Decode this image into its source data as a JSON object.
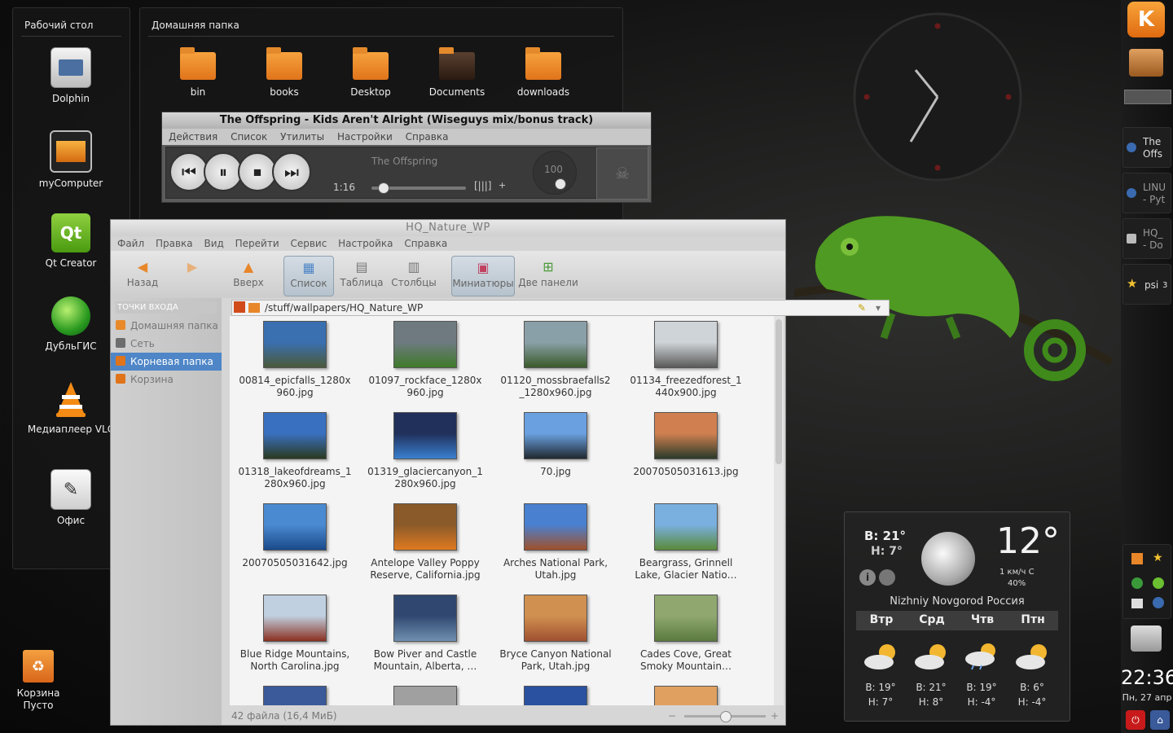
{
  "desktop_panel": {
    "title": "Рабочий стол",
    "icons": [
      {
        "label": "Dolphin",
        "icon": "dolphin-icon"
      },
      {
        "label": "myComputer",
        "icon": "computer-icon"
      },
      {
        "label": "Qt Creator",
        "icon": "qt-creator-icon"
      },
      {
        "label": "ДубльГИС",
        "icon": "dublgis-icon"
      },
      {
        "label": "Медиаплеер VLC",
        "icon": "vlc-icon"
      },
      {
        "label": "Офис",
        "icon": "office-icon"
      }
    ]
  },
  "home_panel": {
    "title": "Домашняя папка",
    "items": [
      {
        "label": "bin"
      },
      {
        "label": "books"
      },
      {
        "label": "Desktop"
      },
      {
        "label": "Documents"
      },
      {
        "label": "downloads"
      }
    ]
  },
  "trash_desktop": {
    "label": "Корзина",
    "sublabel": "Пусто"
  },
  "player": {
    "title": "The Offspring - Kids Aren't Alright (Wiseguys mix/bonus track)",
    "menu": [
      "Действия",
      "Список",
      "Утилиты",
      "Настройки",
      "Справка"
    ],
    "artist": "The Offspring",
    "time": "1:16",
    "volume_label": "100",
    "progress": 0.08,
    "volume": 1.0
  },
  "dolphin": {
    "title": "HQ_Nature_WP",
    "menu": [
      "Файл",
      "Правка",
      "Вид",
      "Перейти",
      "Сервис",
      "Настройка",
      "Справка"
    ],
    "toolbar": {
      "back": "Назад",
      "up": "Вверх",
      "list": "Список",
      "table": "Таблица",
      "columns": "Столбцы",
      "thumbnails": "Миниатюры",
      "split": "Две панели"
    },
    "places_header": "ТОЧКИ ВХОДА",
    "places": [
      {
        "label": "Домашняя папка",
        "selected": false,
        "color": "#e88a2a"
      },
      {
        "label": "Сеть",
        "selected": false,
        "color": "#6d6d6d"
      },
      {
        "label": "Корневая папка",
        "selected": true,
        "color": "#e0741a"
      },
      {
        "label": "Корзина",
        "selected": false,
        "color": "#e0741a"
      }
    ],
    "path": "/stuff/wallpapers/HQ_Nature_WP",
    "files": [
      {
        "name": "00814_epicfalls_1280x\n960.jpg",
        "c1": "#3a6fb0",
        "c2": "#4a5a3a"
      },
      {
        "name": "01097_rockface_1280x\n960.jpg",
        "c1": "#6e7a80",
        "c2": "#3f7a2a"
      },
      {
        "name": "01120_mossbraefalls2\n_1280x960.jpg",
        "c1": "#8aa0a8",
        "c2": "#3a5a2a"
      },
      {
        "name": "01134_freezedforest_1\n440x900.jpg",
        "c1": "#cfd4d8",
        "c2": "#5a5a5a"
      },
      {
        "name": "01318_lakeofdreams_1\n280x960.jpg",
        "c1": "#3a70c0",
        "c2": "#2a3a20"
      },
      {
        "name": "01319_glaciercanyon_1\n280x960.jpg",
        "c1": "#20305a",
        "c2": "#3a80d0"
      },
      {
        "name": "70.jpg",
        "c1": "#6aa0e0",
        "c2": "#202830"
      },
      {
        "name": "20070505031613.jpg",
        "c1": "#d08050",
        "c2": "#2a3a2a"
      },
      {
        "name": "20070505031642.jpg",
        "c1": "#4a8ad0",
        "c2": "#1a4a8a"
      },
      {
        "name": "Antelope Valley Poppy\nReserve, California.jpg",
        "c1": "#8a5a2a",
        "c2": "#e07a20"
      },
      {
        "name": "Arches National Park,\nUtah.jpg",
        "c1": "#4a80d0",
        "c2": "#a0502a"
      },
      {
        "name": "Beargrass, Grinnell\nLake, Glacier Natio…",
        "c1": "#7ab0e0",
        "c2": "#5a8a3a"
      },
      {
        "name": "Blue Ridge Mountains,\nNorth Carolina.jpg",
        "c1": "#c0d0e0",
        "c2": "#8a3020"
      },
      {
        "name": "Bow Piver and Castle\nMountain, Alberta, …",
        "c1": "#304870",
        "c2": "#7090b0"
      },
      {
        "name": "Bryce Canyon National\nPark, Utah.jpg",
        "c1": "#d09050",
        "c2": "#a05030"
      },
      {
        "name": "Cades Cove, Great\nSmoky Mountain…",
        "c1": "#90a870",
        "c2": "#5a7a40"
      },
      {
        "name": "",
        "c1": "#3a5a9a",
        "c2": "#c0c8d0"
      },
      {
        "name": "",
        "c1": "#a0a0a0",
        "c2": "#e0e0e0"
      },
      {
        "name": "",
        "c1": "#2a50a0",
        "c2": "#ffffff"
      },
      {
        "name": "",
        "c1": "#e0a060",
        "c2": "#c05020"
      }
    ],
    "status": "42 файла (16,4 МиБ)",
    "zoom": 0.5
  },
  "weather": {
    "today_high": "В: 21°",
    "today_low": "Н: 7°",
    "current_temp": "12°",
    "wind": "1 км/ч С",
    "humidity": "40%",
    "location": "Nizhniy Novgorod Россия",
    "days": [
      {
        "name": "Втр",
        "high": "В: 19°",
        "low": "Н: 7°",
        "icon": "partly-cloudy-icon"
      },
      {
        "name": "Срд",
        "high": "В: 21°",
        "low": "Н: 8°",
        "icon": "partly-cloudy-icon"
      },
      {
        "name": "Чтв",
        "high": "В: 19°",
        "low": "Н: -4°",
        "icon": "rain-icon"
      },
      {
        "name": "Птн",
        "high": "В: 6°",
        "low": "Н: -4°",
        "icon": "partly-cloudy-icon"
      }
    ]
  },
  "taskbar": {
    "tasks": [
      {
        "label": "The\nOffs",
        "icon": "browser-icon"
      },
      {
        "label": "LINU\n- Pyt",
        "icon": "browser-icon"
      },
      {
        "label": "HQ_\n- Do",
        "icon": "dolphin-icon"
      },
      {
        "label": "psi",
        "badge": "3",
        "icon": "star-icon"
      }
    ]
  },
  "clock": {
    "time": "22:36",
    "date": "Пн, 27 апр"
  },
  "colors": {
    "accent": "#4e86c7",
    "folder": "#e8862a",
    "kde_menu": "#f08a1c"
  }
}
